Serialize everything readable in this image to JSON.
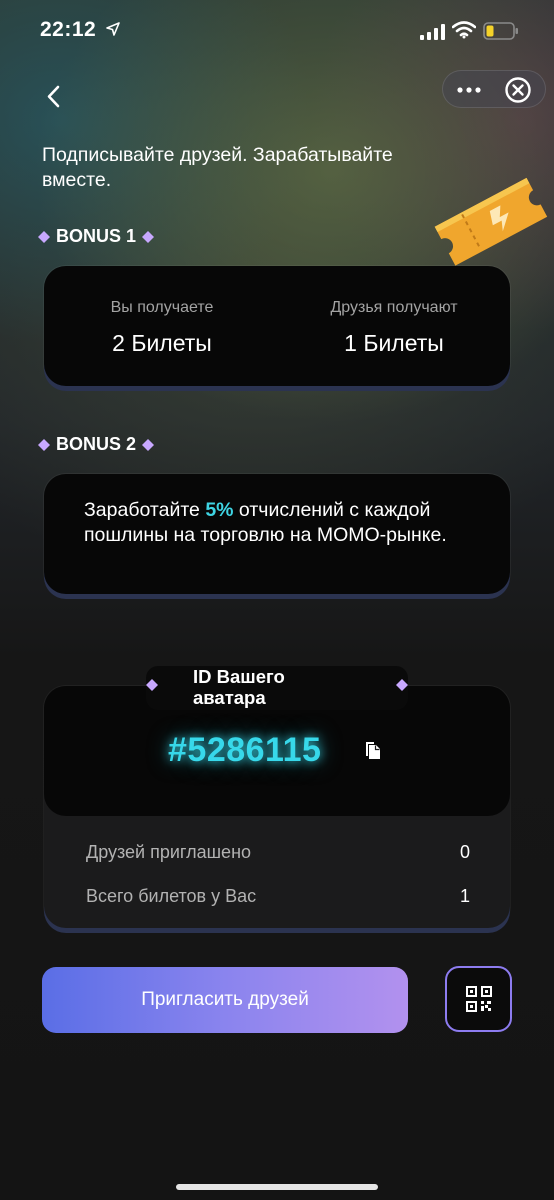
{
  "status_bar": {
    "time": "22:12"
  },
  "header": {
    "headline": "Подписывайте друзей. Зарабатывайте вместе."
  },
  "bonus1": {
    "label": "BONUS 1",
    "you_get_label": "Вы получаете",
    "you_get_value": "2 Билеты",
    "friends_get_label": "Друзья получают",
    "friends_get_value": "1 Билеты"
  },
  "bonus2": {
    "label": "BONUS 2",
    "text_before": "Заработайте ",
    "percent": "5%",
    "text_after": " отчислений с каждой пошлины на торговлю на MOMO-рынке."
  },
  "avatar_card": {
    "label": "ID Вашего аватара",
    "id": "#5286115",
    "stats": [
      {
        "label": "Друзей приглашено",
        "value": "0"
      },
      {
        "label": "Всего билетов у Вас",
        "value": "1"
      }
    ]
  },
  "actions": {
    "invite_label": "Пригласить друзей"
  },
  "colors": {
    "accent_cyan": "#37d8ea",
    "button_gradient_start": "#5a6ee6",
    "button_gradient_end": "#b291ee",
    "diamond": "#c8a8ff"
  },
  "icons": {
    "back": "chevron-left-icon",
    "more": "more-dots-icon",
    "close": "close-circle-icon",
    "ticket": "ticket-icon",
    "copy": "copy-icon",
    "qr": "qr-code-icon"
  }
}
